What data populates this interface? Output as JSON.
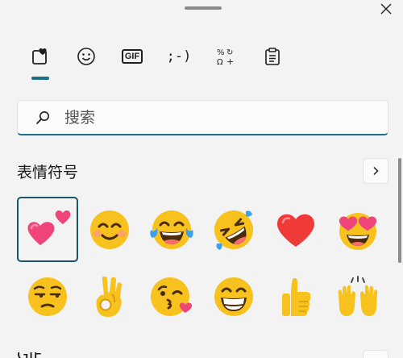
{
  "window": {
    "close_icon": "close-icon"
  },
  "tabs": [
    {
      "name": "emoji",
      "icon": "heart-emoji-icon",
      "selected": true
    },
    {
      "name": "kaomoji-smile",
      "icon": "smiley-icon",
      "selected": false
    },
    {
      "name": "gif",
      "label": "GIF",
      "icon": "gif-icon",
      "selected": false
    },
    {
      "name": "kaomoji",
      "label": ";-)",
      "icon": "kaomoji-icon",
      "selected": false
    },
    {
      "name": "symbols",
      "label": "%↻Ω+",
      "icon": "symbols-icon",
      "selected": false
    },
    {
      "name": "clipboard",
      "icon": "clipboard-icon",
      "selected": false
    }
  ],
  "search": {
    "placeholder": "搜索",
    "value": ""
  },
  "section": {
    "title": "表情符号",
    "next_icon": "chevron-right-icon"
  },
  "emojis": [
    {
      "name": "two-hearts",
      "selected": true
    },
    {
      "name": "smiling-face"
    },
    {
      "name": "face-with-tears-of-joy"
    },
    {
      "name": "rolling-on-floor-laughing"
    },
    {
      "name": "red-heart"
    },
    {
      "name": "heart-eyes"
    },
    {
      "name": "unamused-face"
    },
    {
      "name": "ok-hand"
    },
    {
      "name": "face-blowing-kiss"
    },
    {
      "name": "grinning-face"
    },
    {
      "name": "thumbs-up"
    },
    {
      "name": "raising-hands"
    }
  ],
  "next_section": {
    "title": "GIF"
  },
  "colors": {
    "accent": "#1a6e86",
    "background": "#f3f3f3",
    "emoji_yellow": "#f7c11e",
    "heart_red": "#f03a3a",
    "pink": "#f0457a"
  }
}
